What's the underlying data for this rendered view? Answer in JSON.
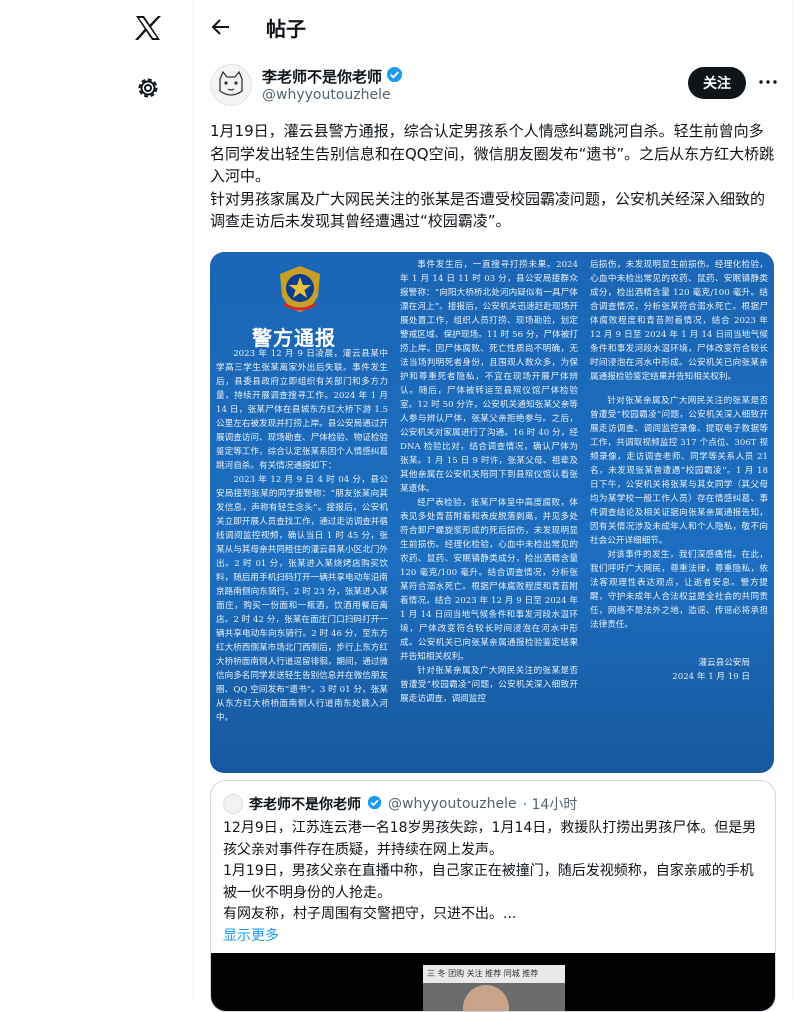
{
  "nav": {
    "logo_icon": "x-logo-icon",
    "settings_icon": "gear-icon"
  },
  "header": {
    "title": "帖子",
    "back_icon": "arrow-left-icon"
  },
  "author": {
    "name": "李老师不是你老师",
    "handle": "@whyyoutouzhele",
    "verified_icon": "verified-badge-icon",
    "follow_label": "关注",
    "more_icon": "more-horizontal-icon"
  },
  "tweet": {
    "paragraphs": [
      "1月19日，灌云县警方通报，综合认定男孩系个人情感纠葛跳河自杀。轻生前曾向多名同学发出轻生告别信息和在QQ空间，微信朋友圈发布“遗书”。之后从东方红大桥跳入河中。",
      "针对男孩家属及广大网民关注的张某是否遭受校园霸凌问题，公安机关经深入细致的调查走访后未发现其曾经遭遇过“校园霸凌”。"
    ]
  },
  "notice": {
    "title": "警方通报",
    "emblem_icon": "police-emblem-icon",
    "col1": [
      "2023 年 12 月 9 日凌晨，灌云县某中学高三学生张某离家外出后失联。事件发生后，县委县政府立即组织有关部门和多方力量，持续开展调查搜寻工作。2024 年 1 月 14 日，张某尸体在县城东方红大桥下游 1.5 公里左右被发现并打捞上岸。县公安局通过开展调查访问、现场勘查、尸体检验、物证检验鉴定等工作，综合认定张某系因个人情感纠葛跳河自杀。有关情况通报如下：",
      "2023 年 12 月 9 日 4 时 04 分，县公安局接到张某的同学报警称：“朋友张某向其发信息，声称有轻生念头”。接报后，公安机关立即开展人员查找工作，通过走访调查并循线调阅监控视频，确认当日 1 时 45 分，张某从与其母亲共同租住的灌云县某小区北门外出。2 时 01 分，张某进入某烧烤店购买饮料，随后用手机扫码打开一辆共享电动车沿南京路南侧向东骑行。2 时 23 分，张某进入某面庄，购买一份面和一瓶酒，饮酒用餐后离店。2 时 42 分，张某在面庄门口扫码打开一辆共享电动车向东骑行。2 时 46 分，至东方红大桥西侧某市场北门西侧后，步行上东方红大桥桥面南侧人行道逗留徘徊，期间，通过微信向多名同学发送轻生告别信息并在微信朋友圈、QQ 空间发布“遗书”。3 时 01 分，张某从东方红大桥桥面南侧人行道南东处跳入河中。"
    ],
    "col2": [
      "事件发生后，一直搜寻打捞未果。2024 年 1 月 14 日 11 时 03 分，县公安局接群众报警称：“向阳大桥桥北处河内疑似有一具尸体漂在河上”。接报后，公安机关迅速赶赴现场开展处置工作，组织人员打捞、现场勘验，划定警戒区域、保护现场。11 时 56 分，尸体被打捞上岸。因尸体腐败、死亡性质尚不明确，无法当场判明死者身份，且围观人数众多，为保护和尊重死者隐私，不宜在现场开展尸体辨认。随后，尸体被转运至县殡仪馆尸体检验室。12 时 50 分许，公安机关通知张某父亲等人参与辨认尸体，张某父亲拒绝参与。之后，公安机关对家属进行了沟通。16 时 40 分，经 DNA 检验比对，结合调查情况，确认尸体为张某。1 月 15 日 9 时许，张某父母、祖辈及其他亲属在公安机关陪同下到县殡仪馆认看张某遗体。",
      "经尸表检验，张某尸体呈中高度腐败，体表见多处青苔附着和表皮脱落剥离，并见多处符合卸尸螺旋浆形成的死后损伤，未发现明显生前损伤。经理化检验，心血中未检出常见的农药、鼠药、安眠镇静类成分，检出酒精含量 120 毫克/100 毫升。结合调查情况，分析张某符合溺水死亡。根据尸体腐败程度和青苔附着情况，结合 2023 年 12 月 9 日至 2024 年 1 月 14 日间当地气候条件和事发河段水温环境，尸体改变符合较长时间浸泡在河水中形成。公安机关已向张某亲属通报检验鉴定结果并告知相关权利。",
      "针对张某亲属及广大网民关注的张某是否曾遭受“校园霸凌”问题，公安机关深入细致开展走访调查，调阅监控"
    ],
    "col3": [
      "后损伤，未发现明显生前损伤。经理化检验，心血中未检出常见的农药、鼠药、安眠镇静类成分，检出酒精含量 120 毫克/100 毫升。结合调查情况，分析张某符合溺水死亡。根据尸体腐败程度和青苔附着情况，结合 2023 年 12 月 9 日至 2024 年 1 月 14 日间当地气候条件和事发河段水温环境，尸体改变符合较长时间浸泡在河水中形成。公安机关已向张某亲属通报检验鉴定结果并告知相关权利。",
      "针对张某亲属及广大网民关注的张某是否曾遭受“校园霸凌”问题，公安机关深入细致开展走访调查、调阅监控录像、提取电子数据等工作，共调取视频监控 317 个点位、306T 视频录像，走访调查老师、同学等关系人员 21 名，未发现张某曾遭遇“校园霸凌”。1 月 18 日下午，公安机关将张某与其女同学（其父母均为某学校一般工作人员）存在情感纠葛、事件调查结论及相关证据向张某亲属通报告知，因有关情况涉及未成年人和个人隐私，敬不向社会公开详细细节。",
      "对该事件的发生，我们深感痛惜。在此，我们呼吁广大网民，尊重法律，尊重隐私，依法客观理性表达观点，让逝者安息。警方提醒，守护未成年人合法权益是全社会的共同责任，网络不是法外之地，造谣、传谣必将承担法律责任。",
      "灌云县公安局",
      "2024 年 1 月 19 日"
    ]
  },
  "quote": {
    "name": "李老师不是你老师",
    "handle": "@whyyoutouzhele",
    "time": "· 14小时",
    "paragraphs": [
      "12月9日，江苏连云港一名18岁男孩失踪，1月14日，救援队打捞出男孩尸体。但是男孩父亲对事件存在质疑，并持续在网上发声。",
      "1月19日，男孩父亲在直播中称，自己家正在被撞门，随后发视频称，自家亲戚的手机被一伙不明身份的人抢走。",
      "有网友称，村子周围有交警把守，只进不出。..."
    ],
    "show_more": "显示更多",
    "media_bar": "三 冬  团购  关注  推荐  同城  推荐"
  }
}
